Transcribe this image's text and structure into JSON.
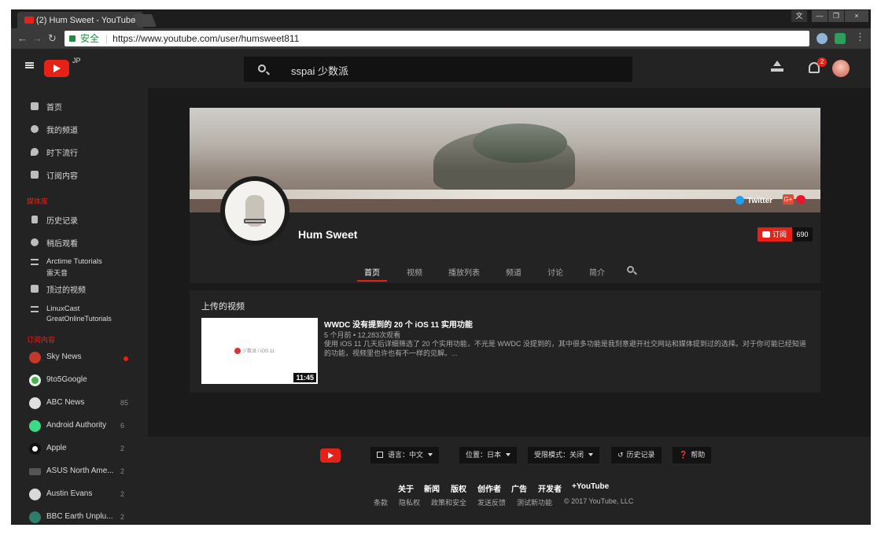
{
  "browser": {
    "tab_title": "(2) Hum Sweet - YouTube",
    "tab_close": "×",
    "win_controls": [
      "文",
      "—",
      "❐",
      "×"
    ],
    "secure_label": "安全",
    "url": "https://www.youtube.com/user/humsweet811"
  },
  "header": {
    "region": "JP",
    "search_query": "sspai 少数派",
    "notification_count": "2"
  },
  "sidebar": {
    "main_items": [
      {
        "label": "首页",
        "icon": "home-icon"
      },
      {
        "label": "我的频道",
        "icon": "account-icon"
      },
      {
        "label": "时下流行",
        "icon": "flame-icon"
      },
      {
        "label": "订阅内容",
        "icon": "subscriptions-icon"
      }
    ],
    "library_heading": "媒体库",
    "library_items": [
      {
        "label": "历史记录",
        "icon": "hourglass-icon"
      },
      {
        "label": "稍后观看",
        "icon": "clock-icon"
      },
      {
        "label": "Arctime Tutorials",
        "label2": "雷天音",
        "icon": "playlist-icon"
      },
      {
        "label": "顶过的视频",
        "icon": "thumbs-up-icon"
      },
      {
        "label": "LinuxCast",
        "label2": "GreatOnlineTutorials",
        "icon": "playlist-icon"
      }
    ],
    "subs_heading": "订阅内容",
    "subscriptions": [
      {
        "label": "Sky News",
        "count": "",
        "new_dot": true,
        "color": "#c0392b"
      },
      {
        "label": "9to5Google",
        "count": "",
        "new_dot": false,
        "color": "#4caf50"
      },
      {
        "label": "ABC News",
        "count": "85",
        "new_dot": false,
        "color": "#e0e0e0"
      },
      {
        "label": "Android Authority",
        "count": "6",
        "new_dot": false,
        "color": "#3ddc84"
      },
      {
        "label": "Apple",
        "count": "2",
        "new_dot": false,
        "color": "#ffffff"
      },
      {
        "label": "ASUS North Ame...",
        "count": "2",
        "new_dot": false,
        "color": "#555555"
      },
      {
        "label": "Austin Evans",
        "count": "2",
        "new_dot": false,
        "color": "#d9d9d9"
      },
      {
        "label": "BBC Earth Unplu...",
        "count": "2",
        "new_dot": false,
        "color": "#2e7d6b"
      }
    ]
  },
  "channel": {
    "twitter_label": "Twitter",
    "gplus_label": "G+",
    "name": "Hum Sweet",
    "subscribe_label": "订阅",
    "subscriber_count": "690",
    "tabs": [
      "首页",
      "视频",
      "播放列表",
      "频道",
      "讨论",
      "简介"
    ],
    "active_tab": "首页"
  },
  "uploads": {
    "heading": "上传的视频",
    "video": {
      "title": "WWDC 没有提到的 20 个 iOS 11 实用功能",
      "meta": "5 个月前 • 12,283次观看",
      "description": "使用 iOS 11 几天后详细筛选了 20 个实用功能，不光是 WWDC 没提到的，其中很多功能是我刻意避开社交网站和媒体提到过的选择。对于你可能已经知道的功能，视频里也许也有不一样的见解。...",
      "duration": "11:45",
      "thumb_brand": "少数派",
      "thumb_sep": "/",
      "thumb_os": "iOS 11"
    }
  },
  "footer": {
    "language": "语言：中文",
    "location": "位置：日本",
    "restricted": "受限模式：关闭",
    "history": "历史记录",
    "help": "帮助",
    "links_primary": [
      "关于",
      "新闻",
      "版权",
      "创作者",
      "广告",
      "开发者",
      "+YouTube"
    ],
    "links_secondary": [
      "条款",
      "隐私权",
      "政策和安全",
      "发送反馈",
      "测试新功能",
      "© 2017 YouTube, LLC"
    ]
  },
  "colors": {
    "brand_red": "#e62117",
    "bg_dark": "#232323",
    "bg_main": "#1a1a1a"
  }
}
